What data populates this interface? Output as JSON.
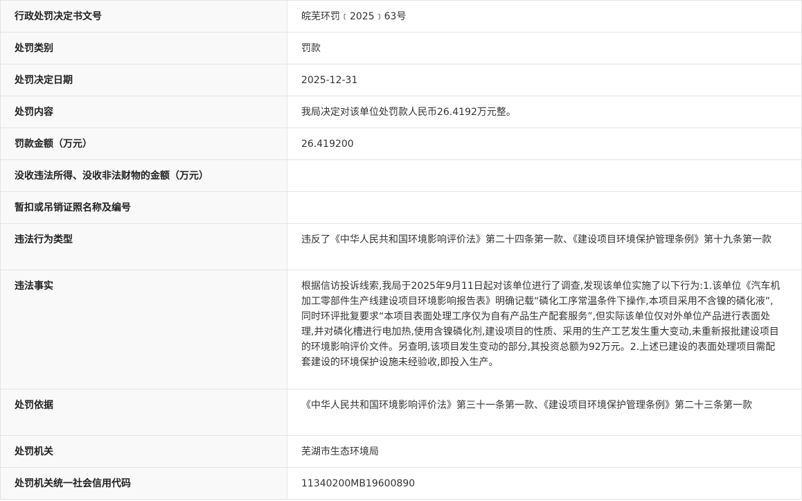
{
  "rows": [
    {
      "label": "行政处罚决定书文号",
      "value": "皖芜环罚﹝2025﹞63号"
    },
    {
      "label": "处罚类别",
      "value": "罚款"
    },
    {
      "label": "处罚决定日期",
      "value": "2025-12-31"
    },
    {
      "label": "处罚内容",
      "value": "我局决定对该单位处罚款人民币26.4192万元整。"
    },
    {
      "label": "罚款金额（万元）",
      "value": "26.419200"
    },
    {
      "label": "没收违法所得、没收非法财物的金额（万元）",
      "value": ""
    },
    {
      "label": "暂扣或吊销证照名称及编号",
      "value": ""
    },
    {
      "label": "违法行为类型",
      "value": "违反了《中华人民共和国环境影响评价法》第二十四条第一款、《建设项目环境保护管理条例》第十九条第一款"
    },
    {
      "label": "违法事实",
      "value": "根据信访投诉线索,我局于2025年9月11日起对该单位进行了调查,发现该单位实施了以下行为:1.该单位《汽车机加工零部件生产线建设项目环境影响报告表》明确记载“磷化工序常温条件下操作,本项目采用不含镍的磷化液”,同时环评批复要求“本项目表面处理工序仅为自有产品生产配套服务”,但实际该单位仅对外单位产品进行表面处理,并对磷化槽进行电加热,使用含镍磷化剂,建设项目的性质、采用的生产工艺发生重大变动,未重新报批建设项目的环境影响评价文件。另查明,该项目发生变动的部分,其投资总额为92万元。2.上述已建设的表面处理项目需配套建设的环境保护设施未经验收,即投入生产。"
    },
    {
      "label": "处罚依据",
      "value": "《中华人民共和国环境影响评价法》第三十一条第一款、《建设项目环境保护管理条例》第二十三条第一款"
    },
    {
      "label": "处罚机关",
      "value": "芜湖市生态环境局"
    },
    {
      "label": "处罚机关统一社会信用代码",
      "value": "11340200MB19600890"
    }
  ]
}
